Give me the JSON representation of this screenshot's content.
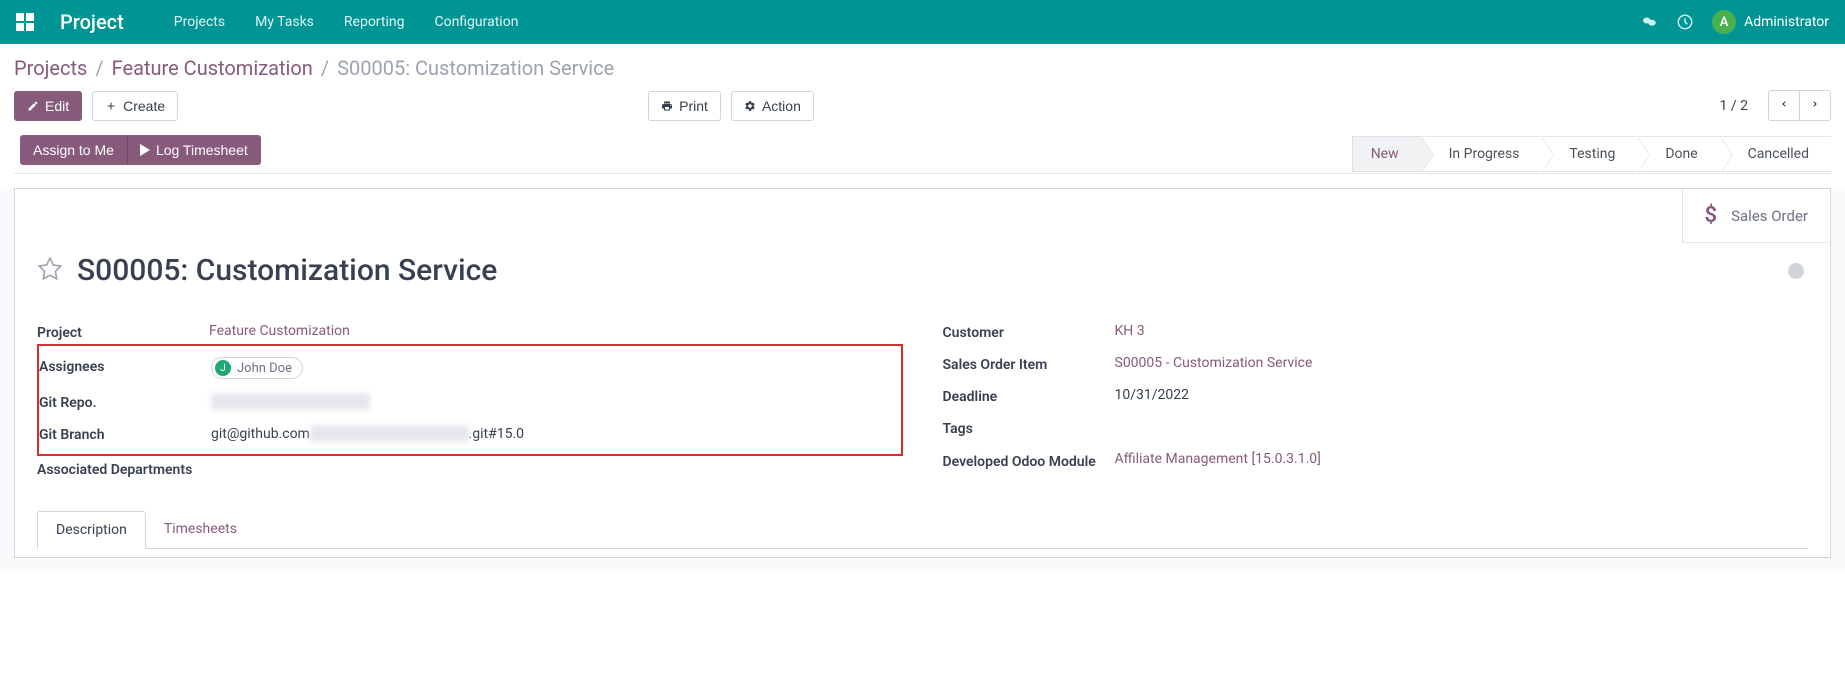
{
  "navbar": {
    "brand": "Project",
    "menu": [
      "Projects",
      "My Tasks",
      "Reporting",
      "Configuration"
    ],
    "user_initial": "A",
    "user_name": "Administrator"
  },
  "breadcrumb": {
    "items": [
      "Projects",
      "Feature Customization"
    ],
    "current": "S00005: Customization Service"
  },
  "buttons": {
    "edit": "Edit",
    "create": "Create",
    "print": "Print",
    "action": "Action",
    "assign": "Assign to Me",
    "log_timesheet": "Log Timesheet"
  },
  "pager": {
    "text": "1 / 2"
  },
  "stages": {
    "items": [
      "New",
      "In Progress",
      "Testing",
      "Done",
      "Cancelled"
    ],
    "active_index": 0
  },
  "stat_button": {
    "label": "Sales Order"
  },
  "record": {
    "title": "S00005: Customization Service",
    "left": {
      "project_label": "Project",
      "project_value": "Feature Customization",
      "assignees_label": "Assignees",
      "assignee_initial": "J",
      "assignee_name": "John Doe",
      "git_repo_label": "Git Repo.",
      "git_repo_value": "████████████████",
      "git_branch_label": "Git Branch",
      "git_branch_prefix": "git@github.com",
      "git_branch_hidden": "████████████████",
      "git_branch_suffix": ".git#15.0",
      "departments_label": "Associated Departments"
    },
    "right": {
      "customer_label": "Customer",
      "customer_value": "KH 3",
      "so_item_label": "Sales Order Item",
      "so_item_value": "S00005 - Customization Service",
      "deadline_label": "Deadline",
      "deadline_value": "10/31/2022",
      "tags_label": "Tags",
      "module_label": "Developed Odoo Module",
      "module_value": "Affiliate Management [15.0.3.1.0]"
    }
  },
  "tabs": {
    "items": [
      "Description",
      "Timesheets"
    ],
    "active_index": 0
  }
}
